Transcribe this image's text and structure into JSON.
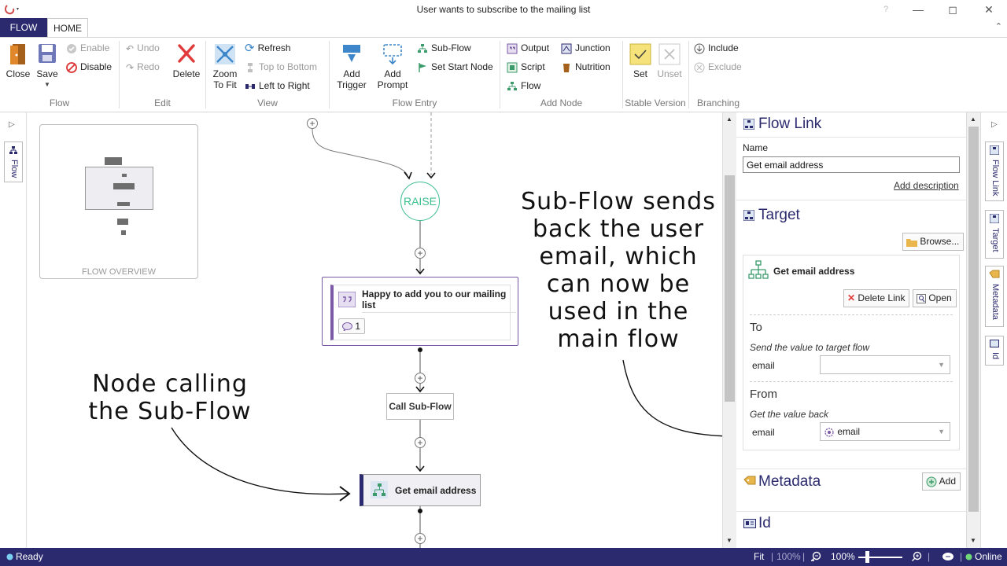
{
  "window": {
    "title": "User wants to subscribe to the mailing list"
  },
  "ribbon_tabs": {
    "flow": "FLOW",
    "home": "HOME"
  },
  "ribbon": {
    "flow_group": {
      "label": "Flow",
      "close": "Close",
      "save": "Save"
    },
    "edit_group": {
      "label": "Edit",
      "enable": "Enable",
      "disable": "Disable",
      "undo": "Undo",
      "redo": "Redo",
      "delete": "Delete"
    },
    "view_group": {
      "label": "View",
      "zoom_to_fit_1": "Zoom",
      "zoom_to_fit_2": "To Fit",
      "refresh": "Refresh",
      "top_to_bottom": "Top to Bottom",
      "left_to_right": "Left to Right"
    },
    "flow_entry_group": {
      "label": "Flow Entry",
      "add_trigger_1": "Add",
      "add_trigger_2": "Trigger",
      "add_prompt_1": "Add",
      "add_prompt_2": "Prompt",
      "sub_flow": "Sub-Flow",
      "set_start_node": "Set Start Node"
    },
    "add_node_group": {
      "label": "Add Node",
      "output": "Output",
      "script": "Script",
      "flow": "Flow",
      "junction": "Junction",
      "nutrition": "Nutrition"
    },
    "stable_version_group": {
      "label": "Stable Version",
      "set": "Set",
      "unset": "Unset"
    },
    "branching_group": {
      "label": "Branching",
      "include": "Include",
      "exclude": "Exclude"
    }
  },
  "left_panel": {
    "flow_tab": "Flow",
    "overview_label": "FLOW OVERVIEW"
  },
  "canvas": {
    "raise_label": "RAISE",
    "prompt_node": {
      "text": "Happy to add you to our mailing list",
      "count": "1"
    },
    "call_subflow_node": "Call Sub-Flow",
    "subflow_node": "Get email address",
    "annotation_left": "Node calling\nthe Sub-Flow",
    "annotation_right": "Sub-Flow sends\nback the user\nemail, which\ncan now be\nused in the\nmain flow"
  },
  "properties": {
    "flow_link": {
      "title": "Flow Link",
      "name_label": "Name",
      "name_value": "Get email address",
      "add_description": "Add description"
    },
    "target": {
      "title": "Target",
      "browse": "Browse...",
      "target_name": "Get email address",
      "delete_link": "Delete Link",
      "open": "Open",
      "to_title": "To",
      "to_hint": "Send the value to target flow",
      "to_field": "email",
      "to_value": "",
      "from_title": "From",
      "from_hint": "Get the value back",
      "from_field": "email",
      "from_value": "email"
    },
    "metadata": {
      "title": "Metadata",
      "add": "Add"
    },
    "id": {
      "title": "Id"
    }
  },
  "right_tabs": [
    "Flow Link",
    "Target",
    "Metadata",
    "Id"
  ],
  "statusbar": {
    "ready": "Ready",
    "fit": "Fit",
    "zoom_pct_1": "100%",
    "zoom_pct_2": "100%",
    "online": "Online"
  },
  "colors": {
    "brand": "#2b2a6e",
    "raise": "#3dbf8f",
    "prompt_border": "#7a5aa6",
    "subflow_bar": "#2b2a6e"
  }
}
